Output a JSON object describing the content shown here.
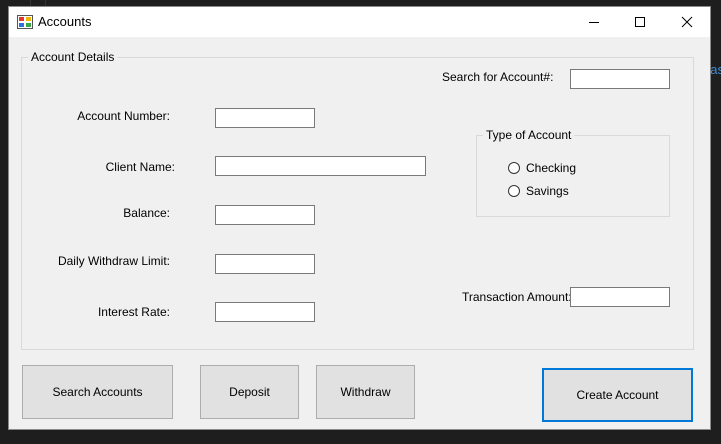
{
  "background": {
    "partial_text": "pas"
  },
  "window": {
    "title": "Accounts",
    "controls": {
      "minimize": "minimize-icon",
      "maximize": "maximize-icon",
      "close": "close-icon"
    }
  },
  "account_details": {
    "caption": "Account Details",
    "search_label": "Search for Account#:",
    "search_value": "",
    "account_number_label": "Account Number:",
    "account_number_value": "",
    "client_name_label": "Client Name:",
    "client_name_value": "",
    "balance_label": "Balance:",
    "balance_value": "",
    "daily_limit_label": "Daily Withdraw Limit:",
    "daily_limit_value": "",
    "interest_rate_label": "Interest Rate:",
    "interest_rate_value": "",
    "transaction_label": "Transaction Amount:",
    "transaction_value": "",
    "type_of_account": {
      "caption": "Type of Account",
      "options": [
        "Checking",
        "Savings"
      ],
      "selected": null
    }
  },
  "buttons": {
    "search_accounts": "Search Accounts",
    "deposit": "Deposit",
    "withdraw": "Withdraw",
    "create_account": "Create Account"
  },
  "colors": {
    "accent": "#0078d7",
    "window_bg": "#f0f0f0",
    "desktop_bg": "#1e1e1e"
  }
}
